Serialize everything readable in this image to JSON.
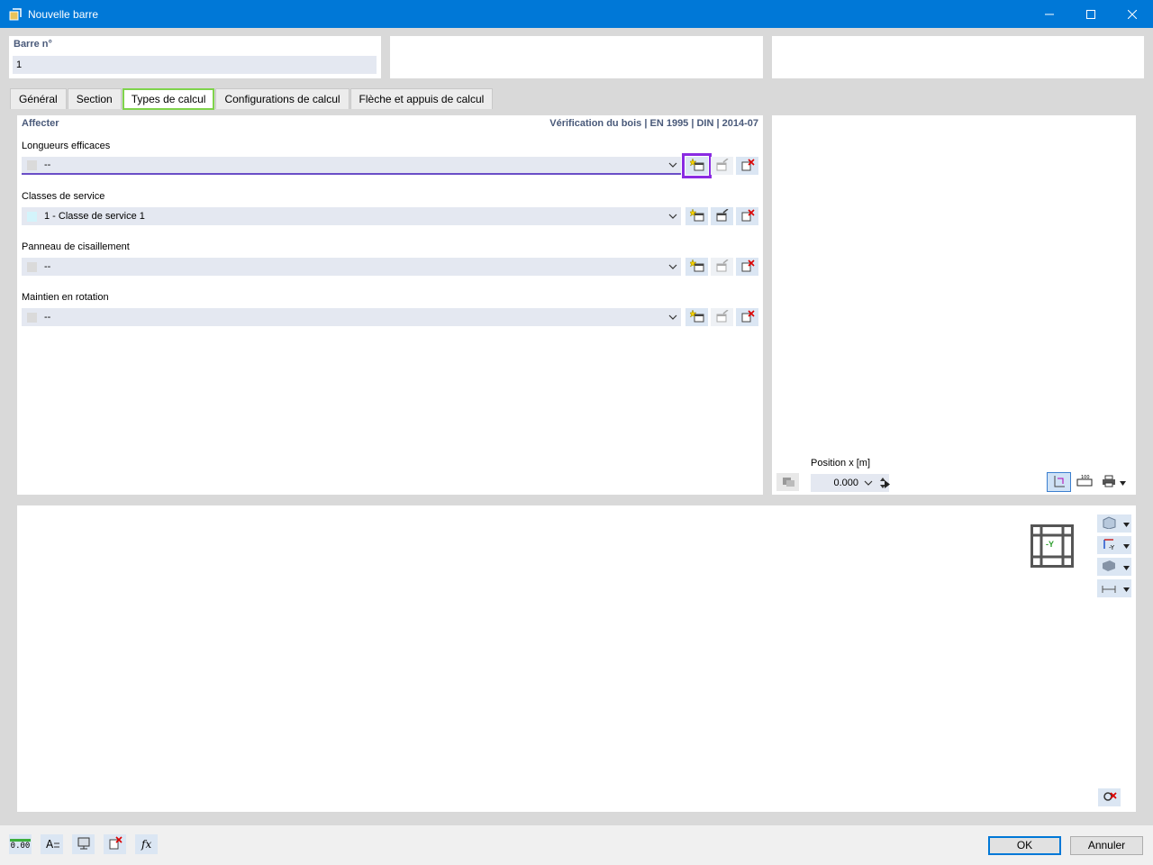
{
  "window": {
    "title": "Nouvelle barre",
    "minimize_icon": "minimize-icon",
    "maximize_icon": "maximize-icon",
    "close_icon": "close-icon"
  },
  "header": {
    "bar_number_label": "Barre n°",
    "bar_number_value": "1"
  },
  "tabs": [
    {
      "label": "Général"
    },
    {
      "label": "Section"
    },
    {
      "label": "Types de calcul",
      "active": true
    },
    {
      "label": "Configurations de calcul"
    },
    {
      "label": "Flèche et appuis de calcul"
    }
  ],
  "main": {
    "section_title": "Affecter",
    "norm_info": "Vérification du bois | EN 1995 | DIN | 2014-07",
    "fields": [
      {
        "label": "Longueurs efficaces",
        "value": "--",
        "swatch": "#dadada"
      },
      {
        "label": "Classes de service",
        "value": "1 - Classe de service 1",
        "swatch": "#d3f4fb"
      },
      {
        "label": "Panneau de cisaillement",
        "value": "--",
        "swatch": "#dadada"
      },
      {
        "label": "Maintien en rotation",
        "value": "--",
        "swatch": "#dadada"
      }
    ]
  },
  "preview": {
    "position_label": "Position x [m]",
    "position_value": "0.000"
  },
  "view3d": {
    "axis_label": "-Y"
  },
  "footer": {
    "ok_label": "OK",
    "cancel_label": "Annuler",
    "values_icon_text": "0.00"
  },
  "colors": {
    "titlebar": "#0078d7",
    "active_tab_outline": "#7fd34b",
    "highlight_button_outline": "#8a2be2",
    "label_blue": "#4a5a7a"
  }
}
